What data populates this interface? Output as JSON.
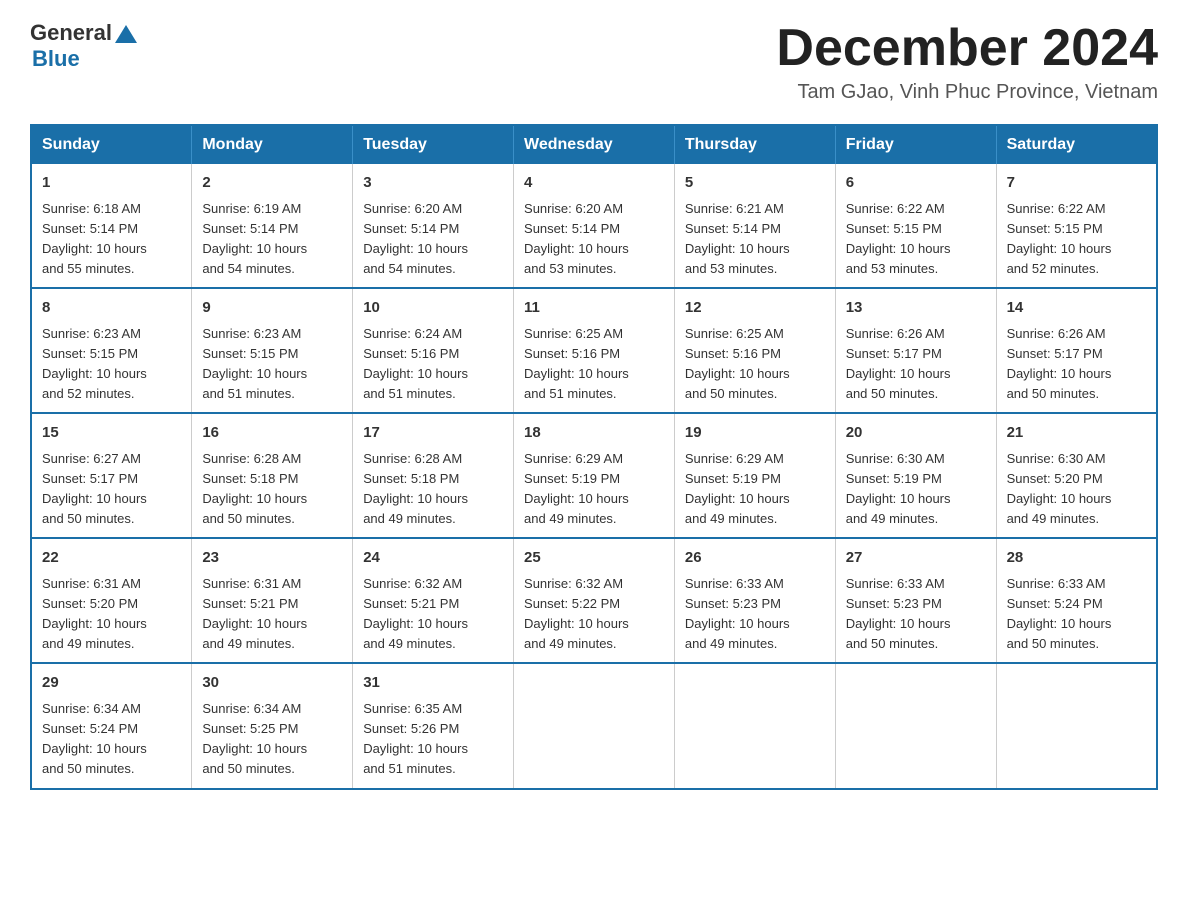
{
  "logo": {
    "text_general": "General",
    "text_blue": "Blue",
    "arrow_symbol": "▲"
  },
  "title": "December 2024",
  "subtitle": "Tam GJao, Vinh Phuc Province, Vietnam",
  "days_of_week": [
    "Sunday",
    "Monday",
    "Tuesday",
    "Wednesday",
    "Thursday",
    "Friday",
    "Saturday"
  ],
  "weeks": [
    [
      {
        "day": "1",
        "sunrise": "6:18 AM",
        "sunset": "5:14 PM",
        "daylight": "10 hours and 55 minutes."
      },
      {
        "day": "2",
        "sunrise": "6:19 AM",
        "sunset": "5:14 PM",
        "daylight": "10 hours and 54 minutes."
      },
      {
        "day": "3",
        "sunrise": "6:20 AM",
        "sunset": "5:14 PM",
        "daylight": "10 hours and 54 minutes."
      },
      {
        "day": "4",
        "sunrise": "6:20 AM",
        "sunset": "5:14 PM",
        "daylight": "10 hours and 53 minutes."
      },
      {
        "day": "5",
        "sunrise": "6:21 AM",
        "sunset": "5:14 PM",
        "daylight": "10 hours and 53 minutes."
      },
      {
        "day": "6",
        "sunrise": "6:22 AM",
        "sunset": "5:15 PM",
        "daylight": "10 hours and 53 minutes."
      },
      {
        "day": "7",
        "sunrise": "6:22 AM",
        "sunset": "5:15 PM",
        "daylight": "10 hours and 52 minutes."
      }
    ],
    [
      {
        "day": "8",
        "sunrise": "6:23 AM",
        "sunset": "5:15 PM",
        "daylight": "10 hours and 52 minutes."
      },
      {
        "day": "9",
        "sunrise": "6:23 AM",
        "sunset": "5:15 PM",
        "daylight": "10 hours and 51 minutes."
      },
      {
        "day": "10",
        "sunrise": "6:24 AM",
        "sunset": "5:16 PM",
        "daylight": "10 hours and 51 minutes."
      },
      {
        "day": "11",
        "sunrise": "6:25 AM",
        "sunset": "5:16 PM",
        "daylight": "10 hours and 51 minutes."
      },
      {
        "day": "12",
        "sunrise": "6:25 AM",
        "sunset": "5:16 PM",
        "daylight": "10 hours and 50 minutes."
      },
      {
        "day": "13",
        "sunrise": "6:26 AM",
        "sunset": "5:17 PM",
        "daylight": "10 hours and 50 minutes."
      },
      {
        "day": "14",
        "sunrise": "6:26 AM",
        "sunset": "5:17 PM",
        "daylight": "10 hours and 50 minutes."
      }
    ],
    [
      {
        "day": "15",
        "sunrise": "6:27 AM",
        "sunset": "5:17 PM",
        "daylight": "10 hours and 50 minutes."
      },
      {
        "day": "16",
        "sunrise": "6:28 AM",
        "sunset": "5:18 PM",
        "daylight": "10 hours and 50 minutes."
      },
      {
        "day": "17",
        "sunrise": "6:28 AM",
        "sunset": "5:18 PM",
        "daylight": "10 hours and 49 minutes."
      },
      {
        "day": "18",
        "sunrise": "6:29 AM",
        "sunset": "5:19 PM",
        "daylight": "10 hours and 49 minutes."
      },
      {
        "day": "19",
        "sunrise": "6:29 AM",
        "sunset": "5:19 PM",
        "daylight": "10 hours and 49 minutes."
      },
      {
        "day": "20",
        "sunrise": "6:30 AM",
        "sunset": "5:19 PM",
        "daylight": "10 hours and 49 minutes."
      },
      {
        "day": "21",
        "sunrise": "6:30 AM",
        "sunset": "5:20 PM",
        "daylight": "10 hours and 49 minutes."
      }
    ],
    [
      {
        "day": "22",
        "sunrise": "6:31 AM",
        "sunset": "5:20 PM",
        "daylight": "10 hours and 49 minutes."
      },
      {
        "day": "23",
        "sunrise": "6:31 AM",
        "sunset": "5:21 PM",
        "daylight": "10 hours and 49 minutes."
      },
      {
        "day": "24",
        "sunrise": "6:32 AM",
        "sunset": "5:21 PM",
        "daylight": "10 hours and 49 minutes."
      },
      {
        "day": "25",
        "sunrise": "6:32 AM",
        "sunset": "5:22 PM",
        "daylight": "10 hours and 49 minutes."
      },
      {
        "day": "26",
        "sunrise": "6:33 AM",
        "sunset": "5:23 PM",
        "daylight": "10 hours and 49 minutes."
      },
      {
        "day": "27",
        "sunrise": "6:33 AM",
        "sunset": "5:23 PM",
        "daylight": "10 hours and 50 minutes."
      },
      {
        "day": "28",
        "sunrise": "6:33 AM",
        "sunset": "5:24 PM",
        "daylight": "10 hours and 50 minutes."
      }
    ],
    [
      {
        "day": "29",
        "sunrise": "6:34 AM",
        "sunset": "5:24 PM",
        "daylight": "10 hours and 50 minutes."
      },
      {
        "day": "30",
        "sunrise": "6:34 AM",
        "sunset": "5:25 PM",
        "daylight": "10 hours and 50 minutes."
      },
      {
        "day": "31",
        "sunrise": "6:35 AM",
        "sunset": "5:26 PM",
        "daylight": "10 hours and 51 minutes."
      },
      null,
      null,
      null,
      null
    ]
  ],
  "labels": {
    "sunrise": "Sunrise:",
    "sunset": "Sunset:",
    "daylight": "Daylight:"
  }
}
